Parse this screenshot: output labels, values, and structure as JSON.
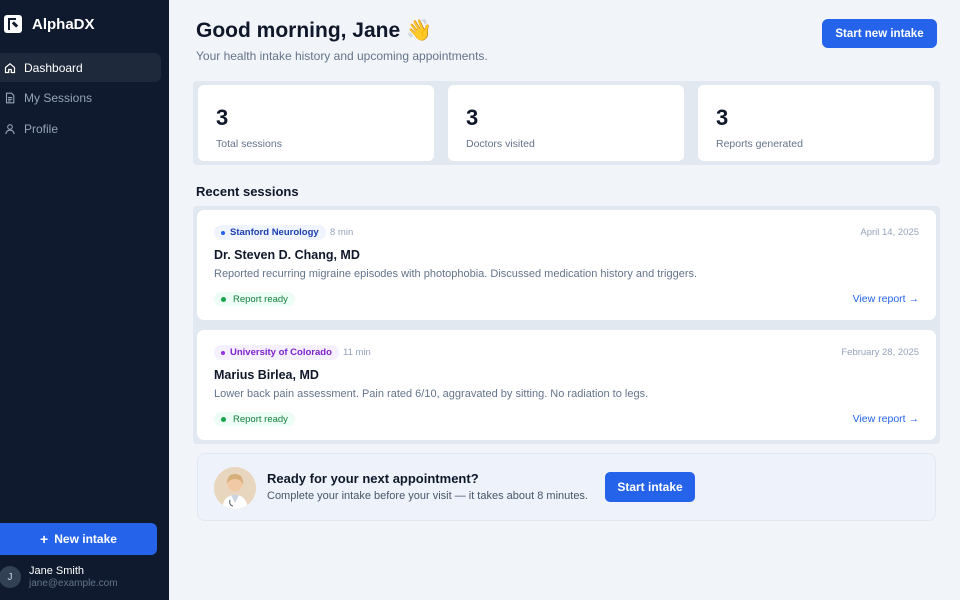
{
  "sidebar": {
    "brand": "AlphaDX",
    "nav": [
      {
        "label": "Dashboard",
        "icon": "home-icon",
        "active": true
      },
      {
        "label": "My Sessions",
        "icon": "document-icon",
        "active": false
      },
      {
        "label": "Profile",
        "icon": "user-icon",
        "active": false
      }
    ],
    "new_intake_label": "New intake",
    "user": {
      "initial": "J",
      "name": "Jane Smith",
      "email": "jane@example.com"
    }
  },
  "header": {
    "greeting": "Good morning, Jane 👋",
    "subtitle": "Your health intake history and upcoming appointments.",
    "start_button": "Start new intake"
  },
  "stats": [
    {
      "value": "3",
      "label": "Total sessions"
    },
    {
      "value": "3",
      "label": "Doctors visited"
    },
    {
      "value": "3",
      "label": "Reports generated"
    }
  ],
  "recent": {
    "title": "Recent sessions",
    "sessions": [
      {
        "institution": "Stanford Neurology",
        "tag_color": "#2563eb",
        "duration": "8 min",
        "date": "April 14, 2025",
        "doctor": "Dr. Steven D. Chang, MD",
        "summary": "Reported recurring migraine episodes with photophobia. Discussed medication history and triggers.",
        "status": "Report ready",
        "link": "View report →"
      },
      {
        "institution": "University of Colorado",
        "tag_color": "#9333ea",
        "duration": "11 min",
        "date": "February 28, 2025",
        "doctor": "Marius Birlea, MD",
        "summary": "Lower back pain assessment. Pain rated 6/10, aggravated by sitting. No radiation to legs.",
        "status": "Report ready",
        "link": "View report →"
      }
    ]
  },
  "cta": {
    "title": "Ready for your next appointment?",
    "subtitle": "Complete your intake before your visit — it takes about 8 minutes.",
    "button": "Start intake"
  },
  "colors": {
    "accent": "#2563eb",
    "sidebar_bg": "#0f1a2e",
    "status_green": "#16a34a"
  }
}
